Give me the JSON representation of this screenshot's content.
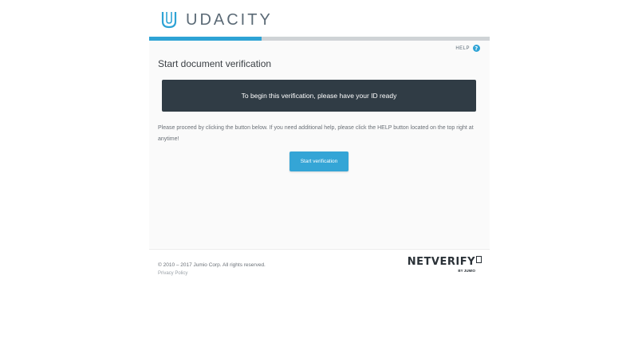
{
  "brand": {
    "name": "UDACITY",
    "logo_icon": "udacity-u-icon",
    "color": "#2ea3d5"
  },
  "progress": {
    "fraction": 0.33
  },
  "help": {
    "label": "HELP",
    "icon": "question-circle-icon",
    "icon_glyph": "?"
  },
  "page": {
    "title": "Start document verification",
    "banner_text": "To begin this verification, please have your ID ready",
    "instructions": "Please proceed by clicking the button below. If you need additional help, please click the HELP button located on the top right at anytime!",
    "start_button_label": "Start verification"
  },
  "footer": {
    "copyright": "© 2010 – 2017 Jumio Corp. All rights reserved.",
    "privacy_link": "Privacy Policy",
    "vendor_name": "NETVERIFY",
    "vendor_byline": "BY JUMIO"
  },
  "colors": {
    "accent": "#2ea3d5",
    "banner_bg": "#303c45",
    "progress_track": "#cfd3d6"
  }
}
